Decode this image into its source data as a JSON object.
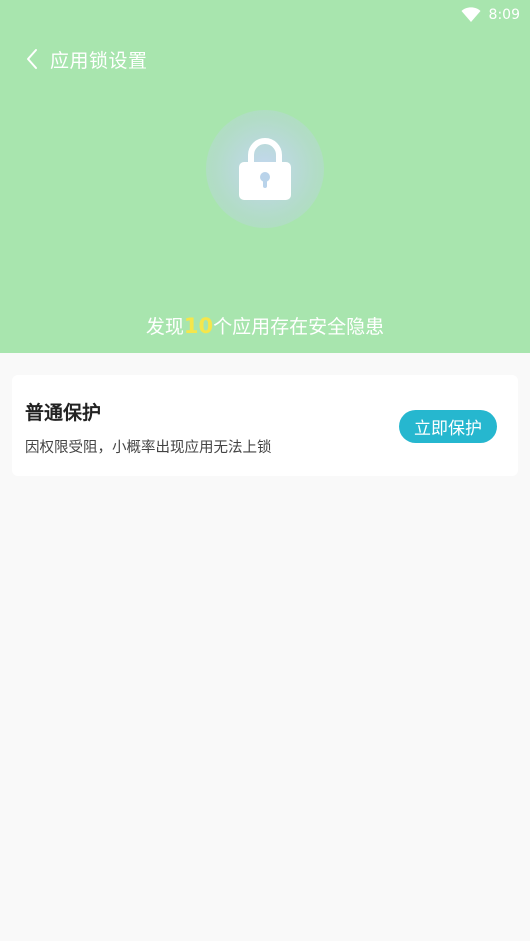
{
  "status_bar": {
    "time": "8:09",
    "wifi_icon": "wifi-icon"
  },
  "nav": {
    "back_icon": "chevron-left-icon",
    "title": "应用锁设置"
  },
  "hero": {
    "lock_icon": "lock-icon",
    "risk_prefix": "发现",
    "risk_count": "10",
    "risk_suffix": "个应用存在安全隐患"
  },
  "card": {
    "title": "普通保护",
    "description": "因权限受阻，小概率出现应用无法上锁",
    "button_label": "立即保护"
  },
  "colors": {
    "header_bg": "#a8e5ae",
    "accent_button": "#26b7cf",
    "count_highlight": "#f5e64b",
    "page_bg": "#f9f9f9"
  }
}
